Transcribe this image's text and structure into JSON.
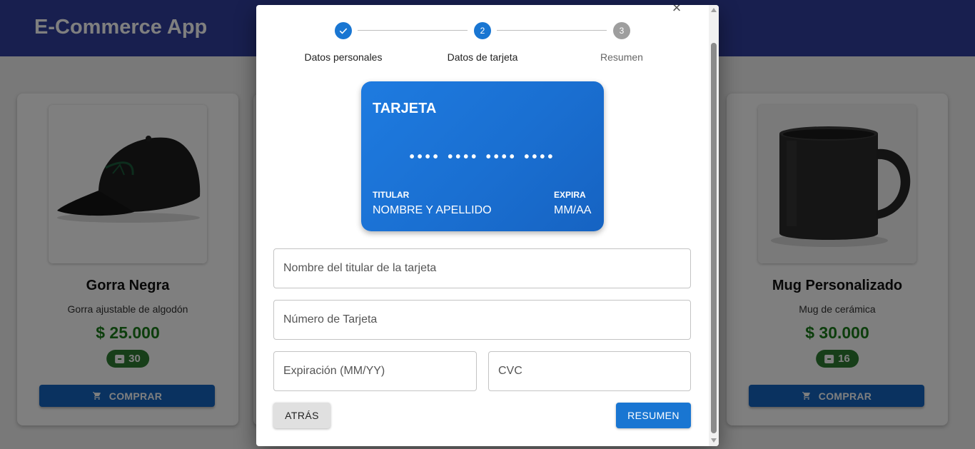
{
  "app": {
    "title": "E-Commerce App"
  },
  "products": [
    {
      "name": "Gorra Negra",
      "description": "Gorra ajustable de algodón",
      "price": "$ 25.000",
      "stock": "30",
      "buy_label": "COMPRAR",
      "image_icon": "cap-image"
    },
    {
      "name": "Mug Personalizado",
      "description": "Mug de cerámica",
      "price": "$ 30.000",
      "stock": "16",
      "buy_label": "COMPRAR",
      "image_icon": "mug-image"
    }
  ],
  "dialog": {
    "steps": [
      {
        "number": "1",
        "label": "Datos personales",
        "state": "completed",
        "icon": "check-icon"
      },
      {
        "number": "2",
        "label": "Datos de tarjeta",
        "state": "active"
      },
      {
        "number": "3",
        "label": "Resumen",
        "state": "pending"
      }
    ],
    "card": {
      "title": "TARJETA",
      "number": "•••• •••• •••• ••••",
      "holder_label": "TITULAR",
      "holder_value": "NOMBRE Y APELLIDO",
      "expiry_label": "EXPIRA",
      "expiry_value": "MM/AA"
    },
    "fields": {
      "holder_placeholder": "Nombre del titular de la tarjeta",
      "number_placeholder": "Número de Tarjeta",
      "expiry_placeholder": "Expiración (MM/YY)",
      "cvc_placeholder": "CVC"
    },
    "back_label": "ATRÁS",
    "next_label": "RESUMEN"
  },
  "colors": {
    "appbar": "#303f9f",
    "primary": "#1976d2",
    "price": "#1b7d1b",
    "stock_badge": "#2e7d32",
    "step_pending": "#9e9e9e"
  }
}
